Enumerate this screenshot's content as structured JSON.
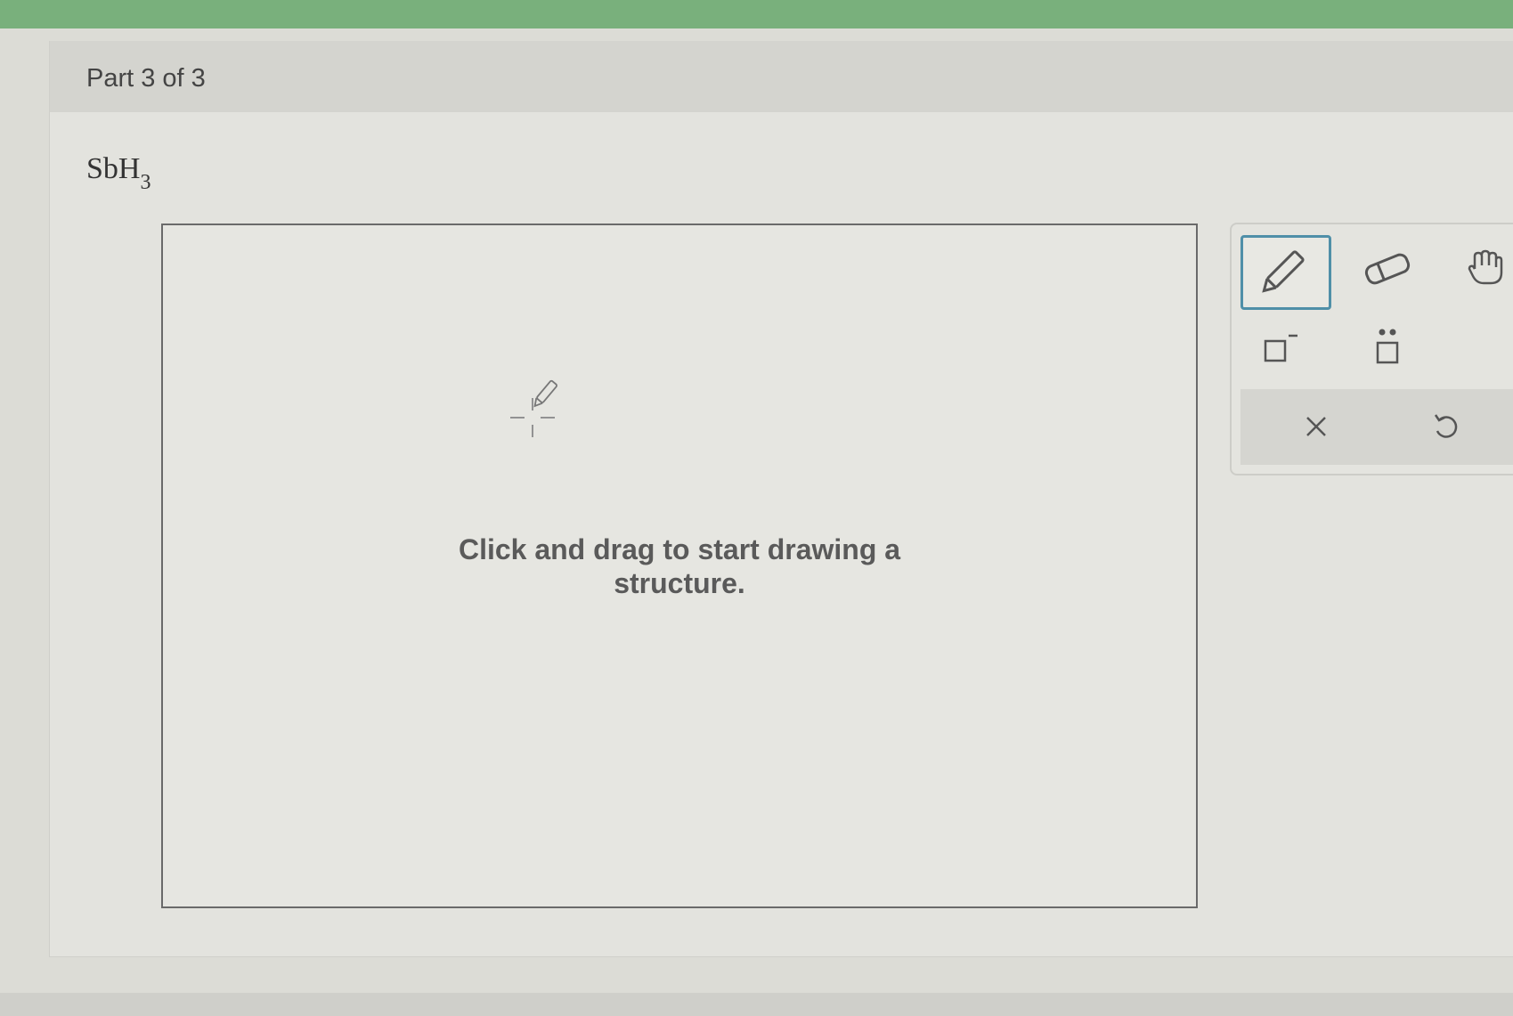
{
  "header": {
    "part_label": "Part 3 of 3"
  },
  "question": {
    "formula_main": "SbH",
    "formula_subscript": "3"
  },
  "canvas": {
    "hint_text": "Click and drag to start drawing a structure."
  },
  "toolbar": {
    "tools": [
      {
        "name": "pencil-icon",
        "selected": true
      },
      {
        "name": "eraser-icon",
        "selected": false
      },
      {
        "name": "hand-icon",
        "selected": false
      },
      {
        "name": "negative-charge-icon",
        "selected": false
      },
      {
        "name": "lone-pair-icon",
        "selected": false
      }
    ],
    "actions": [
      {
        "name": "clear-icon"
      },
      {
        "name": "undo-icon"
      }
    ]
  },
  "colors": {
    "top_bar": "#79b07c",
    "selected_tool_border": "#4f8fa8"
  }
}
